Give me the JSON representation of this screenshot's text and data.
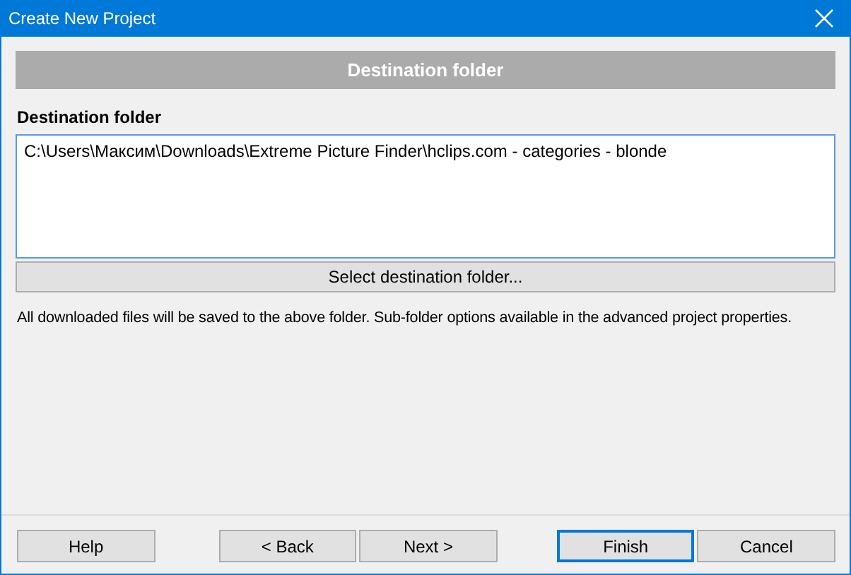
{
  "window": {
    "title": "Create New Project"
  },
  "header": {
    "title": "Destination folder"
  },
  "destination": {
    "label": "Destination folder",
    "value": "C:\\Users\\Максим\\Downloads\\Extreme Picture Finder\\hclips.com - categories - blonde",
    "browse_button": "Select destination folder..."
  },
  "note": "All downloaded files will be saved to the above folder. Sub-folder options available in the advanced project properties.",
  "buttons": [
    {
      "label": "Help",
      "default": false
    },
    {
      "label": "< Back",
      "default": false
    },
    {
      "label": "Next >",
      "default": false
    },
    {
      "label": "Finish",
      "default": true
    },
    {
      "label": "Cancel",
      "default": false
    }
  ]
}
